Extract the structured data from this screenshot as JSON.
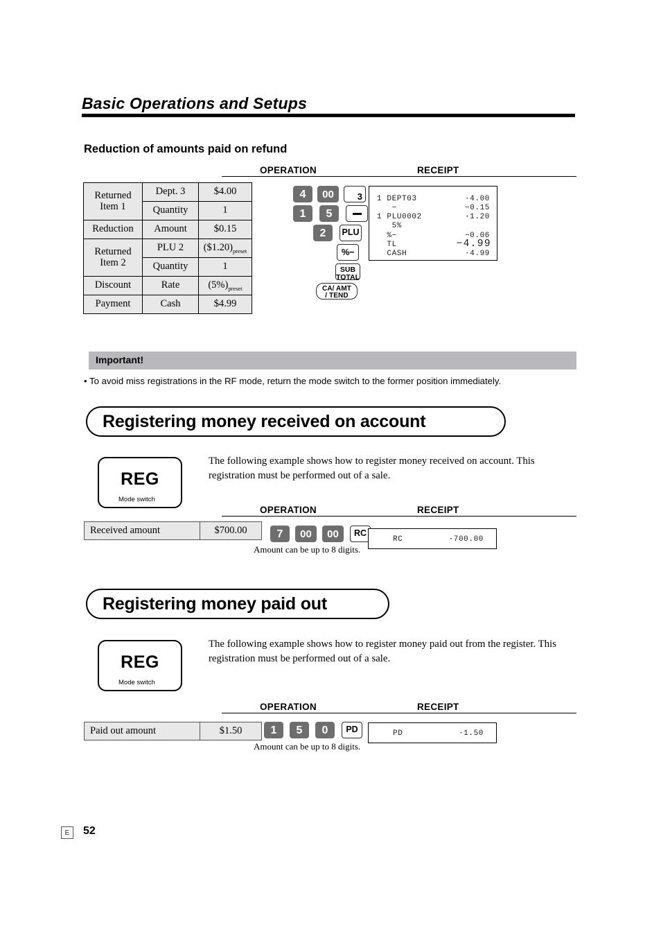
{
  "header": {
    "chapter_title": "Basic Operations and Setups",
    "section_heading": "Reduction of amounts paid on refund"
  },
  "column_headers": {
    "operation": "OPERATION",
    "receipt": "RECEIPT"
  },
  "refund_table": {
    "rows": [
      {
        "c1": "Returned",
        "c1_line2": "Item 1",
        "c2": "Dept. 3",
        "c3": "$4.00"
      },
      {
        "c1": "",
        "c2": "Quantity",
        "c3": "1"
      },
      {
        "c1": "Reduction",
        "c2": "Amount",
        "c3": "$0.15"
      },
      {
        "c1": "Returned",
        "c1_line2": "Item 2",
        "c2": "PLU 2",
        "c3": "($1.20)",
        "c3_sub": "preset"
      },
      {
        "c1": "",
        "c2": "Quantity",
        "c3": "1"
      },
      {
        "c1": "Discount",
        "c2": "Rate",
        "c3": "(5%)",
        "c3_sub": "preset"
      },
      {
        "c1": "Payment",
        "c2": "Cash",
        "c3": "$4.99"
      }
    ]
  },
  "refund_keys": {
    "row1": [
      {
        "type": "num",
        "label": "4"
      },
      {
        "type": "num",
        "label": "00"
      },
      {
        "type": "dept",
        "label": "3"
      }
    ],
    "row2": [
      {
        "type": "num",
        "label": "1"
      },
      {
        "type": "num",
        "label": "5"
      },
      {
        "type": "minus",
        "label": "−"
      }
    ],
    "row3": [
      {
        "type": "num",
        "label": "2"
      },
      {
        "type": "fn",
        "label": "PLU"
      }
    ],
    "row4": [
      {
        "type": "fn",
        "label": "%−"
      }
    ],
    "row5": [
      {
        "type": "fn2",
        "l1": "SUB",
        "l2": "TOTAL"
      }
    ],
    "row6": [
      {
        "type": "catend",
        "l1": "CA/ AMT",
        "l2": "/ TEND"
      }
    ]
  },
  "refund_receipt": {
    "lines": [
      {
        "left": "1 DEPT03",
        "right": "·4.00"
      },
      {
        "left": "   −",
        "right": "−0.15"
      },
      {
        "left": "1 PLU0002",
        "right": "·1.20"
      },
      {
        "left": "   5%",
        "right": ""
      },
      {
        "left": "  %−",
        "right": "−0.06"
      },
      {
        "left": "  TL",
        "right": "−4.99",
        "big": true
      },
      {
        "left": "  CASH",
        "right": "·4.99"
      }
    ]
  },
  "important": {
    "label": "Important!",
    "text": "• To avoid miss registrations in the RF mode, return the mode switch to the former position immediately."
  },
  "section_received": {
    "pill_title": "Registering money received on account",
    "mode": "REG",
    "mode_switch_label": "Mode switch",
    "paragraph": "The following example shows how to register money received on account. This registration must be performed out of a sale.",
    "strip": {
      "label": "Received amount",
      "value": "$700.00"
    },
    "keys": [
      {
        "type": "num",
        "label": "7"
      },
      {
        "type": "num",
        "label": "00"
      },
      {
        "type": "num",
        "label": "00"
      },
      {
        "type": "fn",
        "label": "RC"
      }
    ],
    "note": "Amount can be up to 8 digits.",
    "receipt": {
      "left": "RC",
      "right": "·700.00"
    }
  },
  "section_paidout": {
    "pill_title": "Registering money paid out",
    "mode": "REG",
    "mode_switch_label": "Mode switch",
    "paragraph": "The following example shows how to register money paid out from the register. This registration must be performed out of a sale.",
    "strip": {
      "label": "Paid out amount",
      "value": "$1.50"
    },
    "keys": [
      {
        "type": "num",
        "label": "1"
      },
      {
        "type": "num",
        "label": "5"
      },
      {
        "type": "num",
        "label": "0"
      },
      {
        "type": "fn",
        "label": "PD"
      }
    ],
    "note": "Amount can be up to 8 digits.",
    "receipt": {
      "left": "PD",
      "right": "·1.50"
    }
  },
  "footer": {
    "language_mark": "E",
    "page_number": "52"
  },
  "colors": {
    "key_numeric_bg": "#6e6e6e",
    "table_bg": "#e8e8e8",
    "important_band": "#b9b9bd"
  }
}
